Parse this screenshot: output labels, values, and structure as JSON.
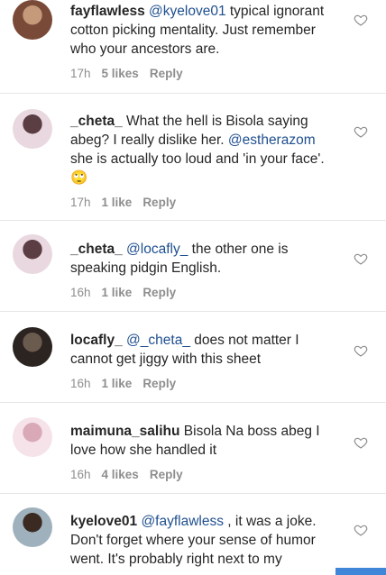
{
  "comments": [
    {
      "username": "fayflawless",
      "parts": [
        {
          "text": "@kyelove01",
          "mention": true
        },
        {
          "text": " typical ignorant cotton picking mentality. Just remember who your ancestors are.",
          "mention": false
        }
      ],
      "time": "17h",
      "likes": "5 likes",
      "reply": "Reply",
      "avatar_colors": [
        "#7a4a38",
        "#c59a7a"
      ]
    },
    {
      "username": "_cheta_",
      "parts": [
        {
          "text": "What the hell is Bisola saying abeg? I really dislike her. ",
          "mention": false
        },
        {
          "text": "@estherazom",
          "mention": true
        },
        {
          "text": " she is actually too loud and 'in your face'. 🙄",
          "mention": false
        }
      ],
      "time": "17h",
      "likes": "1 like",
      "reply": "Reply",
      "avatar_colors": [
        "#e9d8df",
        "#5b3d44"
      ]
    },
    {
      "username": "_cheta_",
      "parts": [
        {
          "text": "@locafly_",
          "mention": true
        },
        {
          "text": " the other one is speaking pidgin English.",
          "mention": false
        }
      ],
      "time": "16h",
      "likes": "1 like",
      "reply": "Reply",
      "avatar_colors": [
        "#e9d8df",
        "#5b3d44"
      ]
    },
    {
      "username": "locafly_",
      "parts": [
        {
          "text": "@_cheta_",
          "mention": true
        },
        {
          "text": " does not matter I cannot get jiggy with this sheet",
          "mention": false
        }
      ],
      "time": "16h",
      "likes": "1 like",
      "reply": "Reply",
      "avatar_colors": [
        "#2b2420",
        "#6b5a4e"
      ]
    },
    {
      "username": "maimuna_salihu",
      "parts": [
        {
          "text": "Bisola Na boss abeg I love how she handled it",
          "mention": false
        }
      ],
      "time": "16h",
      "likes": "4 likes",
      "reply": "Reply",
      "avatar_colors": [
        "#f6e3ea",
        "#d9a9b8"
      ]
    },
    {
      "username": "kyelove01",
      "parts": [
        {
          "text": "@fayflawless",
          "mention": true
        },
        {
          "text": " , it was a joke. Don't forget where your sense of humor went. It's probably right next to my",
          "mention": false
        }
      ],
      "time": "",
      "likes": "",
      "reply": "",
      "avatar_colors": [
        "#9fb1bd",
        "#3a2a22"
      ]
    }
  ],
  "colors": {
    "mention": "#1f4f8f",
    "meta": "#8e8e8e",
    "divider": "#e6e6e6",
    "accent_bar": "#3f86d9"
  },
  "icons": {
    "like": "heart-outline-icon"
  }
}
